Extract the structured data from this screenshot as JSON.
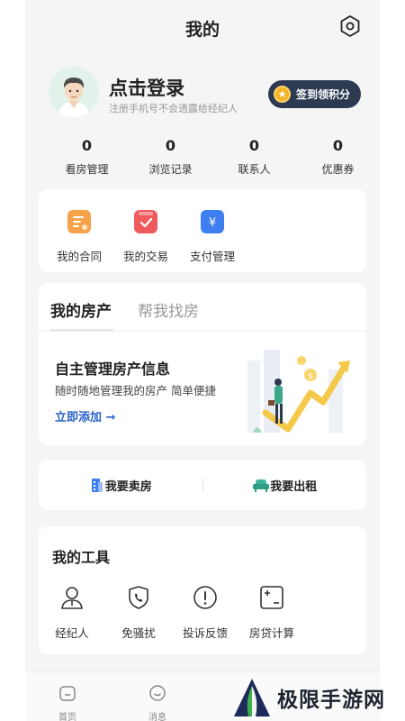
{
  "header": {
    "title": "我的",
    "settings_icon": "settings-hexagon-icon"
  },
  "profile": {
    "login_title": "点击登录",
    "login_subtitle": "注册手机号不会透露给经纪人",
    "signin_label": "签到领积分",
    "signin_coin": "★"
  },
  "stats": [
    {
      "value": "0",
      "label": "看房管理"
    },
    {
      "value": "0",
      "label": "浏览记录"
    },
    {
      "value": "0",
      "label": "联系人"
    },
    {
      "value": "0",
      "label": "优惠券"
    }
  ],
  "quick_actions": [
    {
      "label": "我的合同",
      "icon": "contract-icon"
    },
    {
      "label": "我的交易",
      "icon": "transaction-icon"
    },
    {
      "label": "支付管理",
      "icon": "payment-icon",
      "glyph": "¥"
    }
  ],
  "property": {
    "tab_active": "我的房产",
    "tab_inactive": "帮我找房",
    "title": "自主管理房产信息",
    "subtitle": "随时随地管理我的房产 简单便捷",
    "link": "立即添加 →"
  },
  "sell_rent": {
    "sell": "我要卖房",
    "rent": "我要出租"
  },
  "tools": {
    "title": "我的工具",
    "items": [
      {
        "label": "经纪人",
        "icon": "agent-icon"
      },
      {
        "label": "免骚扰",
        "icon": "no-disturb-phone-icon"
      },
      {
        "label": "投诉反馈",
        "icon": "complaint-icon"
      },
      {
        "label": "房贷计算",
        "icon": "calculator-icon"
      }
    ]
  },
  "tabbar": {
    "home": "首页",
    "messages": "消息"
  },
  "watermark": {
    "text": "极限手游网"
  },
  "colors": {
    "accent": "#2a63c6",
    "signin_bg": "#2d3a52",
    "page_bg": "#f5f5f6"
  }
}
